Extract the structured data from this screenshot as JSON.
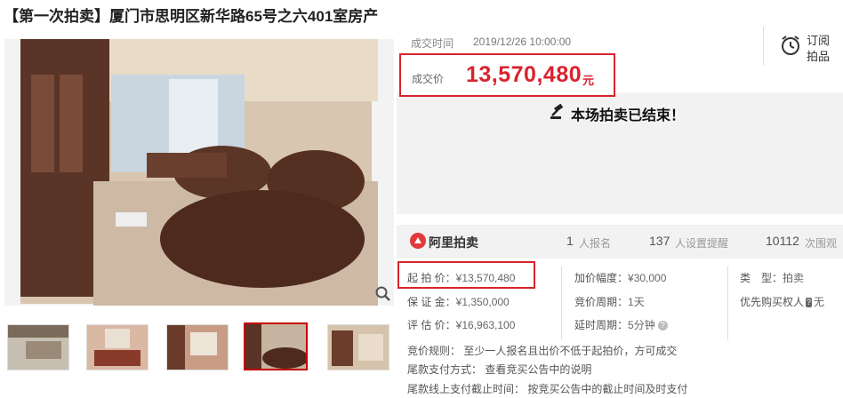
{
  "title": "【第一次拍卖】厦门市思明区新华路65号之六401室房产",
  "deal": {
    "time_label": "成交时间",
    "time": "2019/12/26 10:00:00",
    "price_label": "成交价",
    "price": "13,570,480",
    "unit": "元"
  },
  "subscribe": {
    "label": "订阅拍品"
  },
  "status": {
    "ended": "本场拍卖已结束！"
  },
  "platform": {
    "label": "阿里拍卖"
  },
  "stats": [
    {
      "num": "1",
      "text": "人报名"
    },
    {
      "num": "137",
      "text": "人设置提醒"
    },
    {
      "num": "10112",
      "text": "次围观"
    }
  ],
  "info": {
    "start_price_label": "起 拍 价：",
    "start_price": "¥13,570,480",
    "deposit_label": "保 证 金：",
    "deposit": "¥1,350,000",
    "assess_label": "评 估 价：",
    "assess": "¥16,963,100",
    "increment_label": "加价幅度：",
    "increment": "¥30,000",
    "cycle_label": "竞价周期：",
    "cycle": "1天",
    "delay_label": "延时周期：",
    "delay": "5分钟",
    "type_label": "类　型：",
    "type": "拍卖",
    "priority_label": "优先购买权人",
    "priority_tag": "?",
    "priority_value": "无"
  },
  "rules": {
    "bid_rule": "竞价规则：   至少一人报名且出价不低于起拍价，方可成交",
    "payment_method": "尾款支付方式：   查看竞买公告中的说明",
    "payment_deadline": "尾款线上支付截止时间：   按竞买公告中的截止时间及时支付"
  },
  "icons": {
    "zoom": "magnifier-icon",
    "subscribe": "alarm-clock-icon",
    "ended": "gavel-icon",
    "platform": "ali-auction-logo-icon",
    "help": "help-icon"
  },
  "colors": {
    "accent": "#d9232e"
  }
}
